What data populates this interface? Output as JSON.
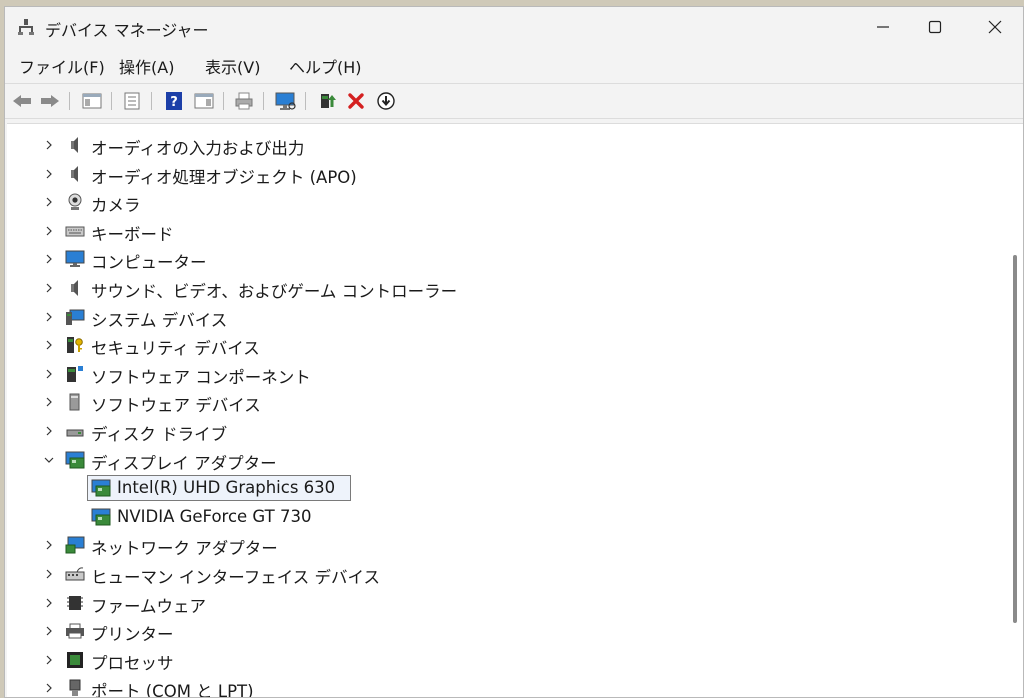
{
  "window": {
    "title": "デバイス マネージャー"
  },
  "menu": [
    {
      "label": "ファイル(F)"
    },
    {
      "label": "操作(A)"
    },
    {
      "label": "表示(V)"
    },
    {
      "label": "ヘルプ(H)"
    }
  ],
  "tree": {
    "categories": [
      {
        "label": "オーディオの入力および出力",
        "icon": "speaker-icon",
        "expanded": false
      },
      {
        "label": "オーディオ処理オブジェクト (APO)",
        "icon": "speaker-icon",
        "expanded": false
      },
      {
        "label": "カメラ",
        "icon": "webcam-icon",
        "expanded": false
      },
      {
        "label": "キーボード",
        "icon": "keyboard-icon",
        "expanded": false
      },
      {
        "label": "コンピューター",
        "icon": "monitor-icon",
        "expanded": false
      },
      {
        "label": "サウンド、ビデオ、およびゲーム コントローラー",
        "icon": "speaker-icon",
        "expanded": false
      },
      {
        "label": "システム デバイス",
        "icon": "system-device-icon",
        "expanded": false
      },
      {
        "label": "セキュリティ デバイス",
        "icon": "security-key-icon",
        "expanded": false
      },
      {
        "label": "ソフトウェア コンポーネント",
        "icon": "software-component-icon",
        "expanded": false
      },
      {
        "label": "ソフトウェア デバイス",
        "icon": "software-device-icon",
        "expanded": false
      },
      {
        "label": "ディスク ドライブ",
        "icon": "disk-drive-icon",
        "expanded": false
      },
      {
        "label": "ディスプレイ アダプター",
        "icon": "display-adapter-icon",
        "expanded": true,
        "children": [
          {
            "label": "Intel(R) UHD Graphics 630",
            "icon": "display-adapter-icon",
            "selected": true
          },
          {
            "label": "NVIDIA GeForce GT 730",
            "icon": "display-adapter-icon",
            "selected": false
          }
        ]
      },
      {
        "label": "ネットワーク アダプター",
        "icon": "network-adapter-icon",
        "expanded": false
      },
      {
        "label": "ヒューマン インターフェイス デバイス",
        "icon": "hid-icon",
        "expanded": false
      },
      {
        "label": "ファームウェア",
        "icon": "firmware-chip-icon",
        "expanded": false
      },
      {
        "label": "プリンター",
        "icon": "printer-icon",
        "expanded": false
      },
      {
        "label": "プロセッサ",
        "icon": "processor-icon",
        "expanded": false
      },
      {
        "label": "ポート (COM と LPT)",
        "icon": "port-icon",
        "expanded": false
      }
    ]
  },
  "colors": {
    "accent_red": "#d42020",
    "help_blue": "#1c3fa8",
    "monitor_blue": "#2a7fd4",
    "pcb_green": "#3a8a3a"
  }
}
